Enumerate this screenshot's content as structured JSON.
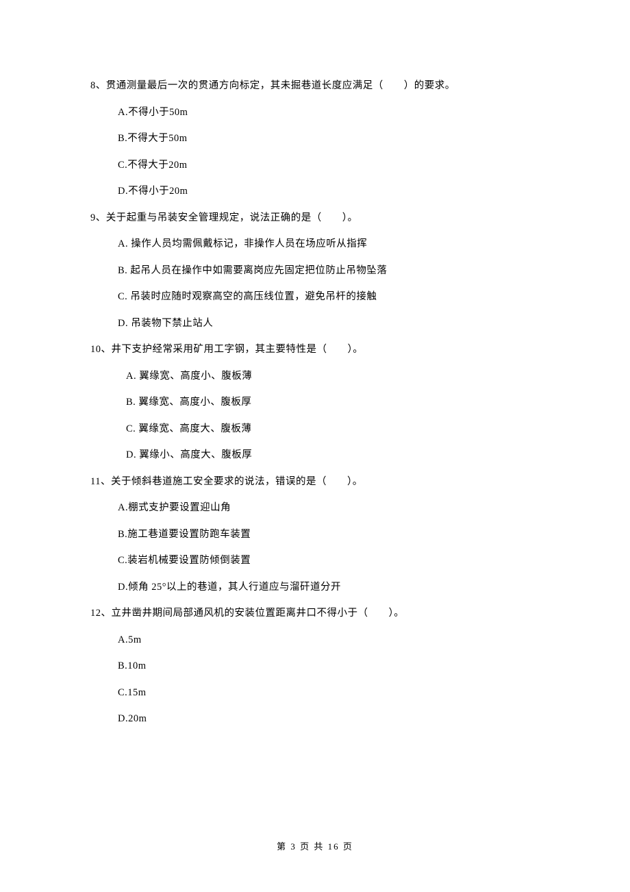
{
  "questions": [
    {
      "stem": "8、贯通测量最后一次的贯通方向标定，其未掘巷道长度应满足（　　）的要求。",
      "options": [
        "A.不得小于50m",
        "B.不得大于50m",
        "C.不得大于20m",
        "D.不得小于20m"
      ]
    },
    {
      "stem": "9、关于起重与吊装安全管理规定，说法正确的是（　　）。",
      "options": [
        "A.  操作人员均需佩戴标记，非操作人员在场应听从指挥",
        "B.  起吊人员在操作中如需要离岗应先固定把位防止吊物坠落",
        "C.  吊装时应随时观察高空的高压线位置，避免吊杆的接触",
        "D.  吊装物下禁止站人"
      ]
    },
    {
      "stem": "10、井下支护经常采用矿用工字钢，其主要特性是（　　）。",
      "options": [
        "A.  翼缘宽、高度小、腹板薄",
        "B.  翼缘宽、高度小、腹板厚",
        "C.  翼缘宽、高度大、腹板薄",
        "D.  翼缘小、高度大、腹板厚"
      ]
    },
    {
      "stem": "11、关于倾斜巷道施工安全要求的说法，错误的是（　　）。",
      "options": [
        "A.棚式支护要设置迎山角",
        "B.施工巷道要设置防跑车装置",
        "C.装岩机械要设置防倾倒装置",
        "D.倾角 25°以上的巷道，其人行道应与溜矸道分开"
      ]
    },
    {
      "stem": "12、立井凿井期间局部通风机的安装位置距离井口不得小于（　　）。",
      "options": [
        "A.5m",
        "B.10m",
        "C.15m",
        "D.20m"
      ]
    }
  ],
  "footer": "第 3 页 共 16 页"
}
